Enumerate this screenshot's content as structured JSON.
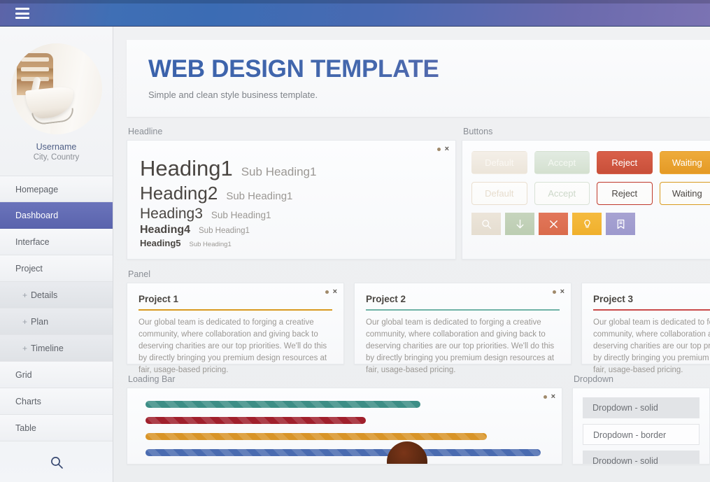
{
  "topbar": {
    "menu_icon": "hamburger-icon"
  },
  "sidebar": {
    "username": "Username",
    "location": "City, Country",
    "avatar_alt": "user-avatar",
    "search_icon": "search-icon",
    "items": [
      {
        "label": "Homepage",
        "active": false,
        "sub": false
      },
      {
        "label": "Dashboard",
        "active": true,
        "sub": false
      },
      {
        "label": "Interface",
        "active": false,
        "sub": false
      },
      {
        "label": "Project",
        "active": false,
        "sub": false
      },
      {
        "label": "Details",
        "active": false,
        "sub": true,
        "prefix": "+"
      },
      {
        "label": "Plan",
        "active": false,
        "sub": true,
        "prefix": "+"
      },
      {
        "label": "Timeline",
        "active": false,
        "sub": true,
        "prefix": "+"
      },
      {
        "label": "Grid",
        "active": false,
        "sub": false
      },
      {
        "label": "Charts",
        "active": false,
        "sub": false
      },
      {
        "label": "Table",
        "active": false,
        "sub": false
      }
    ]
  },
  "hero": {
    "title": "WEB DESIGN TEMPLATE",
    "subtitle": "Simple and clean style business template."
  },
  "sections": {
    "headline": "Headline",
    "buttons": "Buttons",
    "panel": "Panel",
    "loading_bar": "Loading Bar",
    "dropdown": "Dropdown"
  },
  "card_controls": {
    "dot": "minimize-dot",
    "close": "×"
  },
  "headline": {
    "rows": [
      {
        "main": "Heading1",
        "sub": "Sub Heading1"
      },
      {
        "main": "Heading2",
        "sub": "Sub Heading1"
      },
      {
        "main": "Heading3",
        "sub": "Sub Heading1"
      },
      {
        "main": "Heading4",
        "sub": "Sub Heading1"
      },
      {
        "main": "Heading5",
        "sub": "Sub Heading1"
      }
    ]
  },
  "buttons": {
    "solid": [
      {
        "label": "Default",
        "variant": "default",
        "color": "#ece5da"
      },
      {
        "label": "Accept",
        "variant": "accept",
        "color": "#d4e0cf"
      },
      {
        "label": "Reject",
        "variant": "reject",
        "color": "#c84f39"
      },
      {
        "label": "Waiting",
        "variant": "waiting",
        "color": "#e49a25"
      }
    ],
    "outline": [
      {
        "label": "Default",
        "variant": "default",
        "color": "#eadfd0"
      },
      {
        "label": "Accept",
        "variant": "accept",
        "color": "#d9e2d6"
      },
      {
        "label": "Reject",
        "variant": "reject",
        "color": "#c0392b"
      },
      {
        "label": "Waiting",
        "variant": "waiting",
        "color": "#d99a20"
      }
    ],
    "icons": [
      {
        "name": "search-icon",
        "variant": "i-search",
        "color": "#e5ddd0"
      },
      {
        "name": "download-icon",
        "variant": "i-download",
        "color": "#bccdb2"
      },
      {
        "name": "close-icon",
        "variant": "i-close",
        "color": "#da6b4c"
      },
      {
        "name": "lightbulb-icon",
        "variant": "i-idea",
        "color": "#f0b02c"
      },
      {
        "name": "bookmark-icon",
        "variant": "i-bookmark",
        "color": "#9d99cd"
      }
    ]
  },
  "panels": [
    {
      "title": "Project 1",
      "rule_color": "#d99a20",
      "body": "Our global team is dedicated to forging a creative community, where collaboration and giving back to deserving charities are our top priorities. We'll do this by directly bringing you premium design resources at fair, usage-based pricing."
    },
    {
      "title": "Project 2",
      "rule_color": "#6fb3a6",
      "body": "Our global team is dedicated to forging a creative community, where collaboration and giving back to deserving charities are our top priorities. We'll do this by directly bringing you premium design resources at fair, usage-based pricing."
    },
    {
      "title": "Project 3",
      "rule_color": "#c94a4a",
      "body": "Our global team is dedicated to forging a creative community, where collaboration and giving back to deserving charities are our top priorities. We'll do this by directly bringing you premium design resources at fair, usage-based pricing."
    }
  ],
  "loading_bars": [
    {
      "color": "#3d8e86",
      "percent": 66,
      "label": "teal-progress"
    },
    {
      "color": "#a0202c",
      "percent": 53,
      "label": "red-progress"
    },
    {
      "color": "#d89428",
      "percent": 82,
      "label": "orange-progress"
    },
    {
      "color": "#4a6bb0",
      "percent": 95,
      "label": "blue-progress"
    }
  ],
  "dropdowns": [
    {
      "label": "Dropdown - solid",
      "style": "solid"
    },
    {
      "label": "Dropdown - border",
      "style": "border"
    },
    {
      "label": "Dropdown - solid",
      "style": "solid"
    }
  ]
}
